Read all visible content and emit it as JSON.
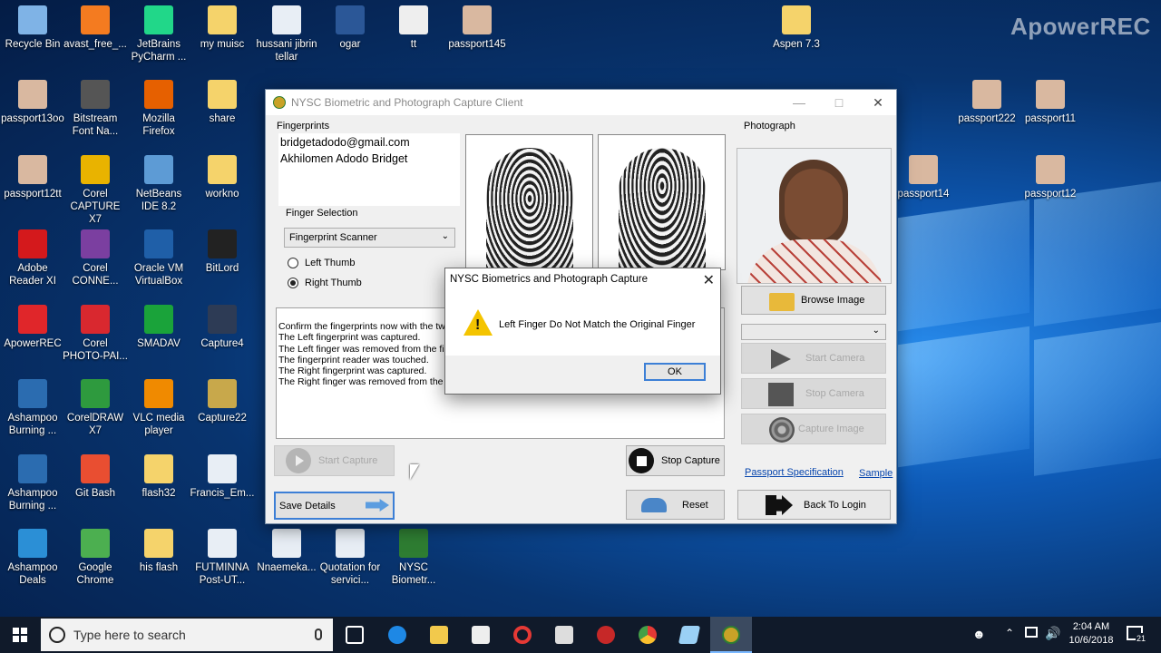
{
  "watermark": "ApowerREC",
  "desktop_icons": [
    {
      "label": "Recycle Bin",
      "icon": "recycle-bin-icon",
      "color": "#7fb3e6"
    },
    {
      "label": "avast_free_...",
      "icon": "avast-icon",
      "color": "#f47b20"
    },
    {
      "label": "JetBrains PyCharm ...",
      "icon": "pycharm-icon",
      "color": "#21d789"
    },
    {
      "label": "my muisc",
      "icon": "folder-icon",
      "color": "#f5d36b"
    },
    {
      "label": "hussani jibrin tellar",
      "icon": "document-icon",
      "color": "#e8eef5"
    },
    {
      "label": "ogar",
      "icon": "word-doc-icon",
      "color": "#2b5797"
    },
    {
      "label": "tt",
      "icon": "text-file-icon",
      "color": "#eeeeee"
    },
    {
      "label": "passport145",
      "icon": "photo-icon",
      "color": "#d9b8a0"
    },
    {
      "label": "Aspen 7.3",
      "icon": "folder-icon",
      "color": "#f5d36b"
    },
    {
      "label": "passport13oo",
      "icon": "photo-icon",
      "color": "#d9b8a0"
    },
    {
      "label": "Bitstream Font Na...",
      "icon": "font-icon",
      "color": "#555555"
    },
    {
      "label": "Mozilla Firefox",
      "icon": "firefox-icon",
      "color": "#e66000"
    },
    {
      "label": "share",
      "icon": "folder-icon",
      "color": "#f5d36b"
    },
    {
      "label": "passport222",
      "icon": "photo-icon",
      "color": "#d9b8a0"
    },
    {
      "label": "passport11",
      "icon": "photo-icon",
      "color": "#d9b8a0"
    },
    {
      "label": "passport12tt",
      "icon": "photo-icon",
      "color": "#d9b8a0"
    },
    {
      "label": "Corel CAPTURE X7",
      "icon": "corel-capture-icon",
      "color": "#e9b300"
    },
    {
      "label": "NetBeans IDE 8.2",
      "icon": "netbeans-icon",
      "color": "#5d9bd5"
    },
    {
      "label": "workno",
      "icon": "folder-icon",
      "color": "#f5d36b"
    },
    {
      "label": "passport14",
      "icon": "photo-icon",
      "color": "#d9b8a0"
    },
    {
      "label": "passport12",
      "icon": "photo-icon",
      "color": "#d9b8a0"
    },
    {
      "label": "Adobe Reader XI",
      "icon": "adobe-reader-icon",
      "color": "#d4191c"
    },
    {
      "label": "Corel CONNE...",
      "icon": "corel-connect-icon",
      "color": "#7b3fa0"
    },
    {
      "label": "Oracle VM VirtualBox",
      "icon": "virtualbox-icon",
      "color": "#1f5fa8"
    },
    {
      "label": "BitLord",
      "icon": "bitlord-icon",
      "color": "#222222"
    },
    {
      "label": "ApowerREC",
      "icon": "apowerrec-icon",
      "color": "#e0262a"
    },
    {
      "label": "Corel PHOTO-PAI...",
      "icon": "corel-photo-paint-icon",
      "color": "#d9282f"
    },
    {
      "label": "SMADAV",
      "icon": "smadav-icon",
      "color": "#1aa33a"
    },
    {
      "label": "Capture4",
      "icon": "capture-icon",
      "color": "#2d3b55"
    },
    {
      "label": "Ashampoo Burning ...",
      "icon": "ashampoo-icon",
      "color": "#2b6cb0"
    },
    {
      "label": "CorelDRAW X7",
      "icon": "coreldraw-icon",
      "color": "#2e9a3e"
    },
    {
      "label": "VLC media player",
      "icon": "vlc-icon",
      "color": "#f08a00"
    },
    {
      "label": "Capture22",
      "icon": "capture-icon",
      "color": "#c8a84b"
    },
    {
      "label": "Ashampoo Burning ...",
      "icon": "ashampoo-icon",
      "color": "#2b6cb0"
    },
    {
      "label": "Git Bash",
      "icon": "git-bash-icon",
      "color": "#e94e31"
    },
    {
      "label": "flash32",
      "icon": "folder-icon",
      "color": "#f5d36b"
    },
    {
      "label": "Francis_Em...",
      "icon": "document-icon",
      "color": "#e8eef5"
    },
    {
      "label": "Ashampoo Deals",
      "icon": "ashampoo-deals-icon",
      "color": "#2b8fd6"
    },
    {
      "label": "Google Chrome",
      "icon": "chrome-icon",
      "color": "#4caf50"
    },
    {
      "label": "his flash",
      "icon": "folder-icon",
      "color": "#f5d36b"
    },
    {
      "label": "FUTMINNA Post-UT...",
      "icon": "document-icon",
      "color": "#e8eef5"
    },
    {
      "label": "Nnaemeka...",
      "icon": "document-icon",
      "color": "#e8eef5"
    },
    {
      "label": "Quotation for servici...",
      "icon": "document-icon",
      "color": "#e8eef5"
    },
    {
      "label": "NYSC Biometr...",
      "icon": "nysc-logo-icon",
      "color": "#2e7d32"
    }
  ],
  "app": {
    "title": "NYSC Biometric and  Photograph Capture Client",
    "fingerprints_label": "Fingerprints",
    "email": "bridgetadodo@gmail.com",
    "name": "Akhilomen Adodo Bridget",
    "finger_selection_label": "Finger Selection",
    "scanner_select": "Fingerprint Scanner",
    "left_thumb": "Left Thumb",
    "right_thumb": "Right Thumb",
    "selected_thumb": "Right Thumb",
    "log_lines": [
      "Confirm the fingerprints now with the two fi",
      "The Left fingerprint was captured.",
      "The Left finger was removed from the finge",
      "The fingerprint reader was touched.",
      "The Right fingerprint was captured.",
      "The Right finger was removed from the fin"
    ],
    "start_capture": "Start Capture",
    "stop_capture": "Stop Capture",
    "save_details": "Save Details",
    "reset": "Reset",
    "photograph_label": "Photograph",
    "browse_image": "Browse Image",
    "start_camera": "Start Camera",
    "stop_camera": "Stop Camera",
    "capture_image": "Capture Image",
    "passport_spec": "Passport Specification",
    "sample": "Sample",
    "back_to_login": "Back To Login"
  },
  "dialog": {
    "title": "NYSC Biometrics and Photograph Capture",
    "message": "Left Finger Do Not Match the Original Finger",
    "ok": "OK",
    "icon": "warning-icon"
  },
  "taskbar": {
    "search_placeholder": "Type here to search",
    "time": "2:04 AM",
    "date": "10/6/2018",
    "notification_count": "21"
  }
}
